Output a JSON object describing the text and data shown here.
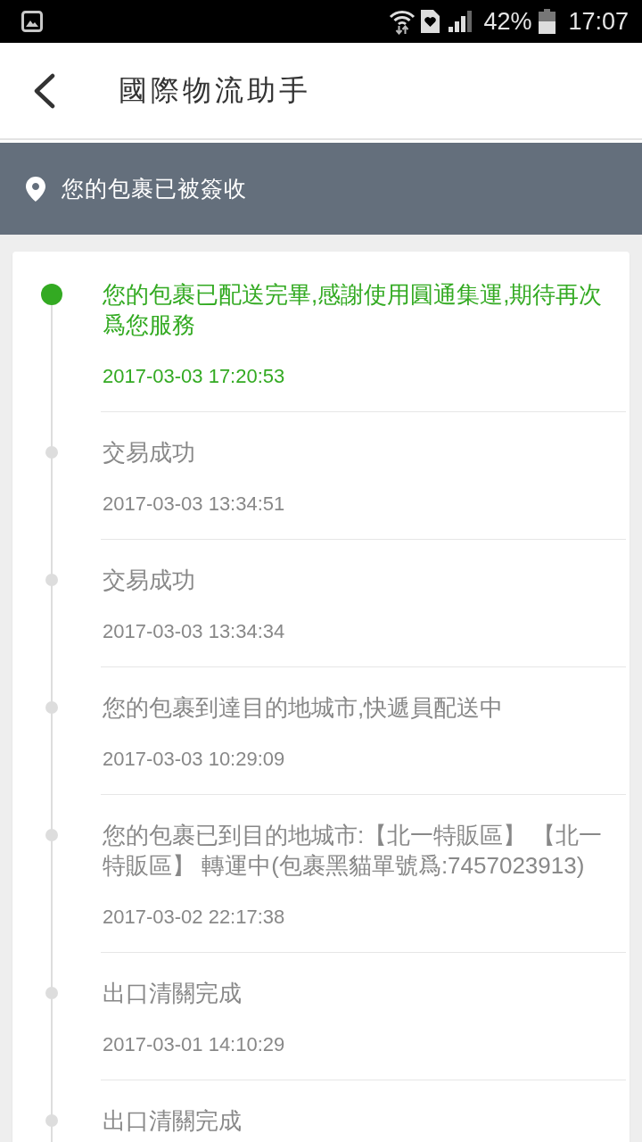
{
  "status_bar": {
    "battery": "42%",
    "time": "17:07"
  },
  "app_bar": {
    "title": "國際物流助手"
  },
  "banner": {
    "text": "您的包裹已被簽收"
  },
  "events": [
    {
      "description": "您的包裹已配送完畢,感謝使用圓通集運,期待再次爲您服務",
      "time": "2017-03-03 17:20:53",
      "current": true
    },
    {
      "description": "交易成功",
      "time": "2017-03-03 13:34:51",
      "current": false
    },
    {
      "description": "交易成功",
      "time": "2017-03-03 13:34:34",
      "current": false
    },
    {
      "description": "您的包裹到達目的地城市,快遞員配送中",
      "time": "2017-03-03 10:29:09",
      "current": false
    },
    {
      "description": "您的包裹已到目的地城市:【北一特販區】 【北一特販區】 轉運中(包裹黑貓單號爲:7457023913)",
      "time": "2017-03-02 22:17:38",
      "current": false
    },
    {
      "description": "出口清關完成",
      "time": "2017-03-01 14:10:29",
      "current": false
    },
    {
      "description": "出口清關完成",
      "current": false
    }
  ]
}
